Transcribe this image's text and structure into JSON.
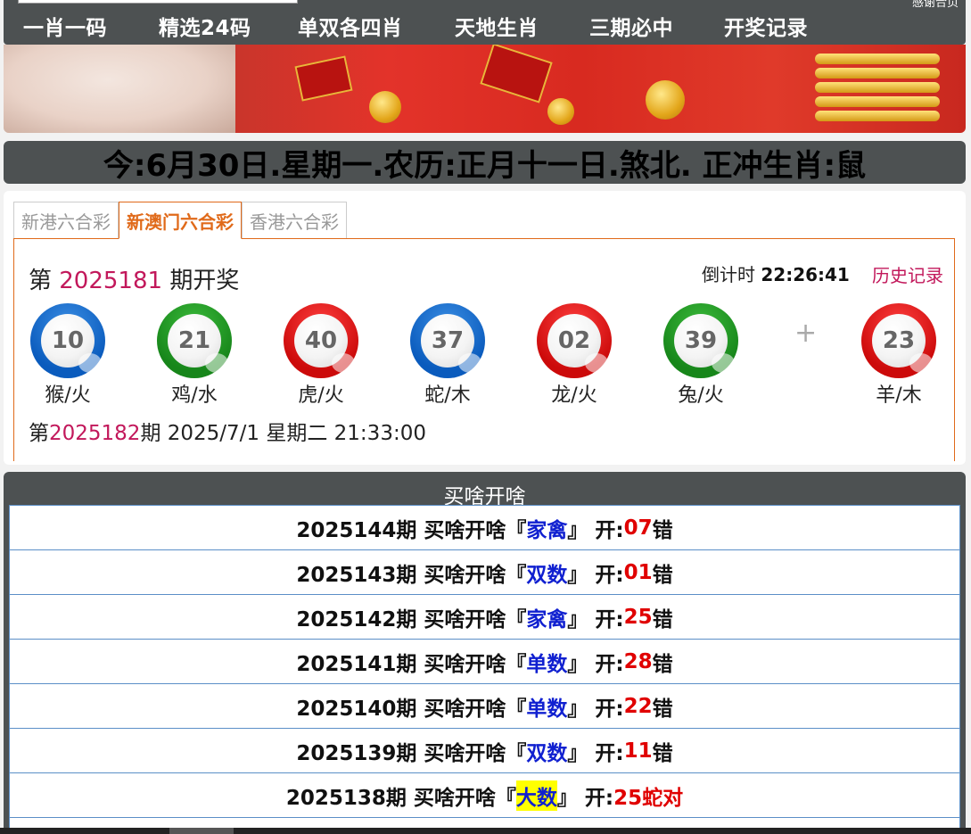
{
  "nav": {
    "items": [
      "一肖一码",
      "精选24码",
      "单双各四肖",
      "天地生肖",
      "三期必中",
      "开奖记录"
    ],
    "corner_text": "感谢合页"
  },
  "date_strip": {
    "text": "今:6月30日.星期一.农历:正月十一日.煞北. 正冲生肖:鼠"
  },
  "tabs": [
    {
      "label": "新港六合彩",
      "active": false
    },
    {
      "label": "新澳门六合彩",
      "active": true
    },
    {
      "label": "香港六合彩",
      "active": false
    }
  ],
  "draw": {
    "prefix": "第 ",
    "period": "2025181",
    "suffix": " 期开奖",
    "countdown_label": "倒计时 ",
    "countdown_value": "22:26:41",
    "history_label": "历史记录",
    "balls": [
      {
        "number": "10",
        "zodiac": "猴/火",
        "color": "blue"
      },
      {
        "number": "21",
        "zodiac": "鸡/水",
        "color": "green"
      },
      {
        "number": "40",
        "zodiac": "虎/火",
        "color": "red"
      },
      {
        "number": "37",
        "zodiac": "蛇/木",
        "color": "blue"
      },
      {
        "number": "02",
        "zodiac": "龙/火",
        "color": "red"
      },
      {
        "number": "39",
        "zodiac": "兔/火",
        "color": "green"
      }
    ],
    "plus": "+",
    "special": {
      "number": "23",
      "zodiac": "羊/木",
      "color": "red"
    },
    "next_prefix": "第",
    "next_period": "2025182",
    "next_suffix": "期 2025/7/1 星期二 21:33:00"
  },
  "buy": {
    "title": "买啥开啥",
    "rows": [
      {
        "period": "2025144期 买啥开啥『",
        "pick": "家禽",
        "mid": "』 开:",
        "num": "07",
        "result": "错",
        "highlight": false
      },
      {
        "period": "2025143期 买啥开啥『",
        "pick": "双数",
        "mid": "』 开:",
        "num": "01",
        "result": "错",
        "highlight": false
      },
      {
        "period": "2025142期 买啥开啥『",
        "pick": "家禽",
        "mid": "』 开:",
        "num": "25",
        "result": "错",
        "highlight": false
      },
      {
        "period": "2025141期 买啥开啥『",
        "pick": "单数",
        "mid": "』 开:",
        "num": "28",
        "result": "错",
        "highlight": false
      },
      {
        "period": "2025140期 买啥开啥『",
        "pick": "单数",
        "mid": "』 开:",
        "num": "22",
        "result": "错",
        "highlight": false
      },
      {
        "period": "2025139期 买啥开啥『",
        "pick": "双数",
        "mid": "』 开:",
        "num": "11",
        "result": "错",
        "highlight": false
      },
      {
        "period": "2025138期 买啥开啥『",
        "pick": "大数",
        "mid": "』 开:",
        "num": "25蛇对",
        "result": "",
        "highlight": true
      }
    ]
  }
}
